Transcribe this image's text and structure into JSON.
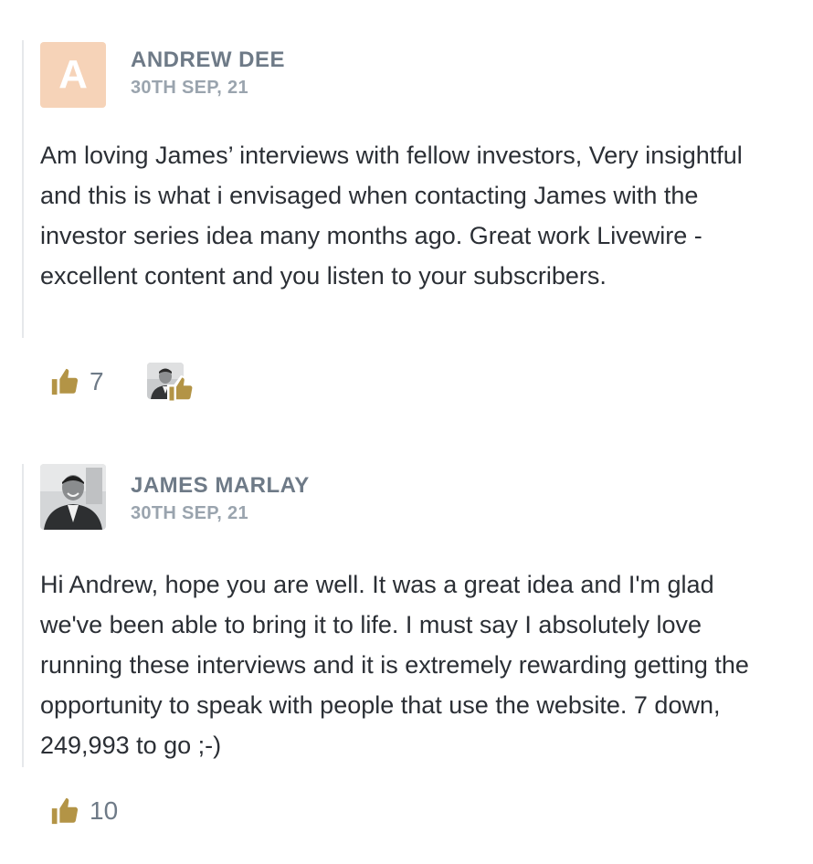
{
  "comments": [
    {
      "author": "ANDREW DEE",
      "avatar_letter": "A",
      "date": "30TH SEP, 21",
      "body": "Am loving James’ interviews with fellow investors, Very insightful and this is what i envisaged when contacting James with the investor series idea many months ago. Great work Livewire - excellent content and you listen to your subscribers.",
      "likes": "7"
    },
    {
      "author": "JAMES MARLAY",
      "date": "30TH SEP, 21",
      "body": "Hi Andrew, hope you are well. It was a great idea and I'm glad we've been able to bring it to life. I must say I absolutely love running these interviews and it is extremely rewarding getting the opportunity to speak with people that use the website. 7 down, 249,993 to go ;-)",
      "likes": "10"
    }
  ],
  "colors": {
    "accent_gold": "#b39446",
    "avatar_letter_bg": "#f6d3b8",
    "name_gray": "#6e7a87"
  },
  "icons": {
    "like": "thumbs-up-icon"
  }
}
